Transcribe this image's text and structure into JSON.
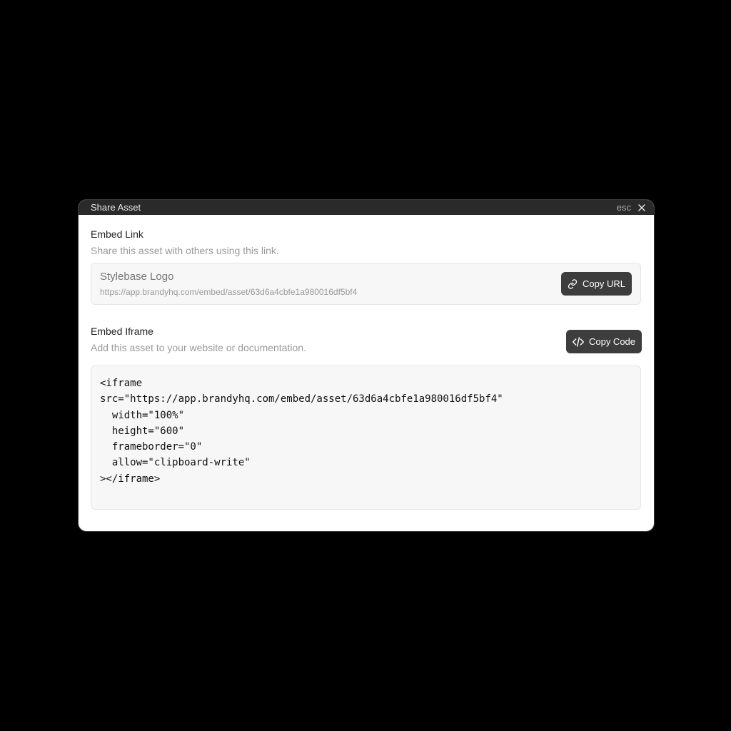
{
  "dialog": {
    "title": "Share Asset",
    "esc_label": "esc",
    "close_icon": "close-icon"
  },
  "embed_link": {
    "heading": "Embed Link",
    "description": "Share this asset with others using this link.",
    "asset_name": "Stylebase Logo",
    "url": "https://app.brandyhq.com/embed/asset/63d6a4cbfe1a980016df5bf4",
    "copy_button_label": "Copy URL",
    "copy_button_icon": "link-icon"
  },
  "embed_iframe": {
    "heading": "Embed Iframe",
    "description": "Add this asset to your website or documentation.",
    "copy_button_label": "Copy Code",
    "copy_button_icon": "code-icon",
    "code": "<iframe\nsrc=\"https://app.brandyhq.com/embed/asset/63d6a4cbfe1a980016df5bf4\"\n  width=\"100%\"\n  height=\"600\"\n  frameborder=\"0\"\n  allow=\"clipboard-write\"\n></iframe>"
  },
  "colors": {
    "background": "#000000",
    "titlebar": "#2a2a2a",
    "button": "#3d3d3d",
    "panel": "#f7f7f7"
  }
}
